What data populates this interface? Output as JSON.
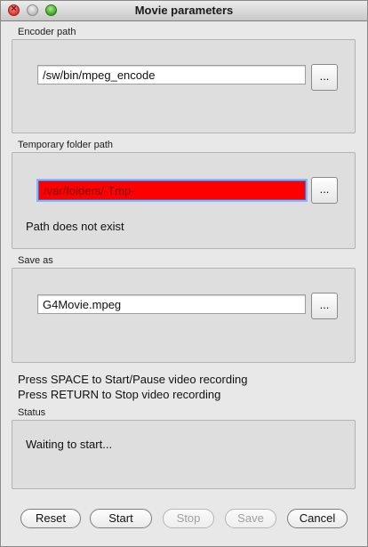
{
  "window": {
    "title": "Movie parameters"
  },
  "encoder": {
    "label": "Encoder path",
    "value": "/sw/bin/mpeg_encode",
    "browse_label": "..."
  },
  "temp_folder": {
    "label": "Temporary folder path",
    "value": "/var/folders/-Tmp-",
    "browse_label": "...",
    "error_message": "Path does not exist",
    "error_color": "#ff0000"
  },
  "save_as": {
    "label": "Save as",
    "value": "G4Movie.mpeg",
    "browse_label": "..."
  },
  "instructions": {
    "line1": "Press SPACE to Start/Pause video recording",
    "line2": "Press RETURN to Stop video recording"
  },
  "status": {
    "label": "Status",
    "text": "Waiting to start..."
  },
  "buttons": {
    "reset": "Reset",
    "start": "Start",
    "stop": "Stop",
    "save": "Save",
    "cancel": "Cancel"
  }
}
